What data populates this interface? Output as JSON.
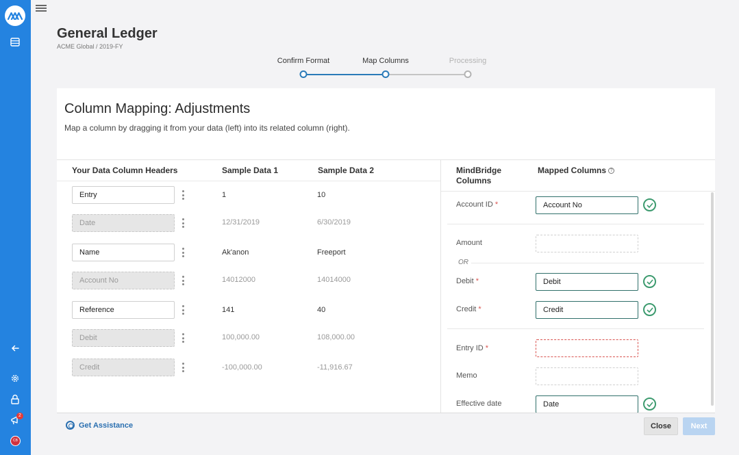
{
  "app": {
    "logo_text": "MM"
  },
  "sidebar": {
    "notification_count": "2",
    "avatar_initials": "CB"
  },
  "header": {
    "title": "General Ledger",
    "breadcrumb": "ACME Global / 2019-FY"
  },
  "stepper": {
    "steps": [
      {
        "label": "Confirm Format",
        "state": "complete"
      },
      {
        "label": "Map Columns",
        "state": "current"
      },
      {
        "label": "Processing",
        "state": "pending"
      }
    ]
  },
  "card": {
    "title": "Column Mapping: Adjustments",
    "subtitle": "Map a column by dragging it from your data (left) into its related column (right)."
  },
  "left_table": {
    "headers": [
      "Your Data Column Headers",
      "Sample Data 1",
      "Sample Data 2"
    ],
    "rows": [
      {
        "column": "Entry",
        "sample1": "1",
        "sample2": "10",
        "mapped": false
      },
      {
        "column": "Date",
        "sample1": "12/31/2019",
        "sample2": "6/30/2019",
        "mapped": true
      },
      {
        "column": "Name",
        "sample1": "Ak'anon",
        "sample2": "Freeport",
        "mapped": false
      },
      {
        "column": "Account No",
        "sample1": "14012000",
        "sample2": "14014000",
        "mapped": true
      },
      {
        "column": "Reference",
        "sample1": "141",
        "sample2": "40",
        "mapped": false
      },
      {
        "column": "Debit",
        "sample1": "100,000.00",
        "sample2": "108,000.00",
        "mapped": true
      },
      {
        "column": "Credit",
        "sample1": "-100,000.00",
        "sample2": "-11,916.67",
        "mapped": true
      }
    ]
  },
  "right_table": {
    "header_mindbridge": "MindBridge Columns",
    "header_mapped": "Mapped Columns",
    "or_text": "OR",
    "required_mark": "*",
    "rows": [
      {
        "label": "Account ID",
        "required": true,
        "value": "Account No",
        "state": "filled"
      },
      {
        "label": "Amount",
        "required": false,
        "value": "",
        "state": "empty"
      },
      {
        "label": "Debit",
        "required": true,
        "value": "Debit",
        "state": "filled"
      },
      {
        "label": "Credit",
        "required": true,
        "value": "Credit",
        "state": "filled"
      },
      {
        "label": "Entry ID",
        "required": true,
        "value": "",
        "state": "error"
      },
      {
        "label": "Memo",
        "required": false,
        "value": "",
        "state": "empty"
      },
      {
        "label": "Effective date",
        "required": false,
        "value": "Date",
        "state": "filled"
      }
    ]
  },
  "footer": {
    "assist_label": "Get Assistance",
    "close_label": "Close",
    "next_label": "Next"
  },
  "colors": {
    "sidebar": "#2483e0",
    "accent": "#2a7ab8",
    "success": "#3c9a6e",
    "error": "#d9534f"
  }
}
